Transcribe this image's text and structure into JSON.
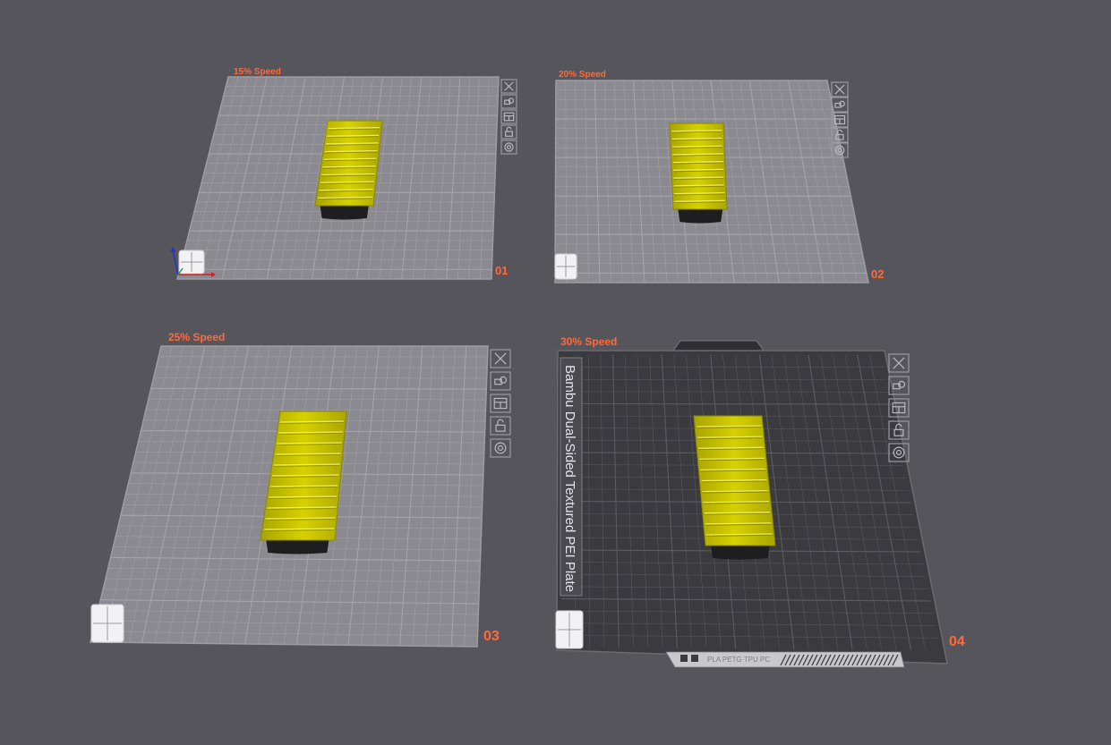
{
  "colors": {
    "background": "#55555b",
    "plate_light": "#8a8a90",
    "plate_dark": "#3a3a3f",
    "grid_line": "#a4a4aa",
    "accent_label": "#ff6a3d",
    "model_yellow": "#c8c400",
    "model_shadow": "#1e1e20"
  },
  "plates": [
    {
      "id": "plate-1",
      "speed_label": "15% Speed",
      "number": "01",
      "style": "light",
      "show_axes": true
    },
    {
      "id": "plate-2",
      "speed_label": "20% Speed",
      "number": "02",
      "style": "light",
      "show_axes": false
    },
    {
      "id": "plate-3",
      "speed_label": "25% Speed",
      "number": "03",
      "style": "light",
      "show_axes": false
    },
    {
      "id": "plate-4",
      "speed_label": "30% Speed",
      "number": "04",
      "style": "dark",
      "show_axes": false,
      "plate_type_text": "Bambu Dual-Sided Textured PEI Plate",
      "bottom_strip_text": "PLA PETG TPU PC"
    }
  ],
  "toolbar_icons": [
    "close-icon",
    "auto-orient-icon",
    "arrange-icon",
    "lock-icon",
    "settings-icon"
  ]
}
